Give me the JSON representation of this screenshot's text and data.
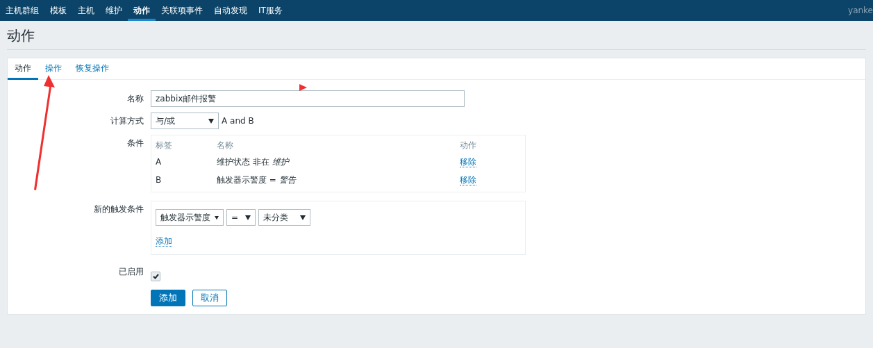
{
  "top_nav": {
    "items": [
      {
        "label": "主机群组",
        "selected": false
      },
      {
        "label": "模板",
        "selected": false
      },
      {
        "label": "主机",
        "selected": false
      },
      {
        "label": "维护",
        "selected": false
      },
      {
        "label": "动作",
        "selected": true
      },
      {
        "label": "关联项事件",
        "selected": false
      },
      {
        "label": "自动发现",
        "selected": false
      },
      {
        "label": "IT服务",
        "selected": false
      }
    ],
    "user": "yanke"
  },
  "page_title": "动作",
  "tabs": [
    {
      "label": "动作",
      "selected": true
    },
    {
      "label": "操作",
      "selected": false
    },
    {
      "label": "恢复操作",
      "selected": false
    }
  ],
  "form": {
    "name": {
      "label": "名称",
      "value": "zabbix邮件报警"
    },
    "calculation": {
      "label": "计算方式",
      "value": "与/或",
      "formula": "A and B"
    },
    "conditions": {
      "label": "条件",
      "columns": [
        "标签",
        "名称",
        "动作"
      ],
      "rows": [
        {
          "tag": "A",
          "name": "维护状态 非在 *维护*",
          "action": "移除"
        },
        {
          "tag": "B",
          "name": "触发器示警度 = *警告*",
          "action": "移除"
        }
      ]
    },
    "new_condition": {
      "label": "新的触发条件",
      "selects": [
        "触发器示警度",
        "=",
        "未分类"
      ],
      "add_link": "添加"
    },
    "enabled": {
      "label": "已启用",
      "checked": true
    },
    "buttons": [
      {
        "label": "添加",
        "kind": "primary"
      },
      {
        "label": "取消",
        "kind": "secondary"
      }
    ]
  }
}
